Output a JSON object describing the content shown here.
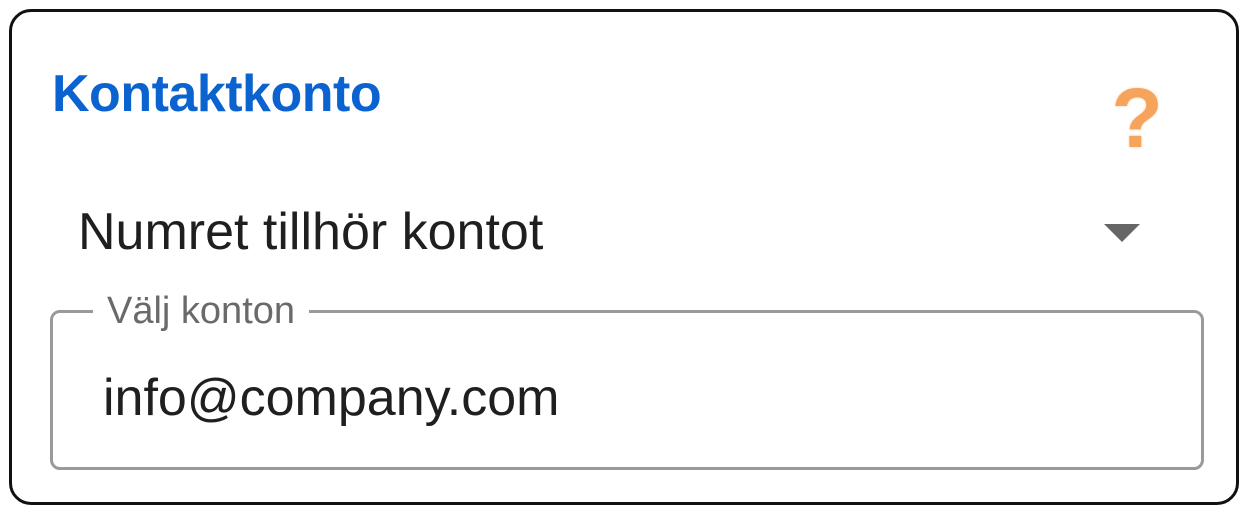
{
  "card": {
    "title": "Kontaktkonto",
    "help_icon": "question-mark-icon",
    "help_glyph": "?"
  },
  "account_select": {
    "selected_value": "Numret tillhör kontot",
    "chevron_icon": "chevron-down-icon"
  },
  "accounts_field": {
    "label": "Välj konton",
    "value": "info@company.com"
  },
  "colors": {
    "title": "#0a63cf",
    "help_icon": "#f6a35b",
    "border": "#111111",
    "field_border": "#9a9a9a",
    "text": "#1f1f1f",
    "label": "#6a6a6a"
  }
}
